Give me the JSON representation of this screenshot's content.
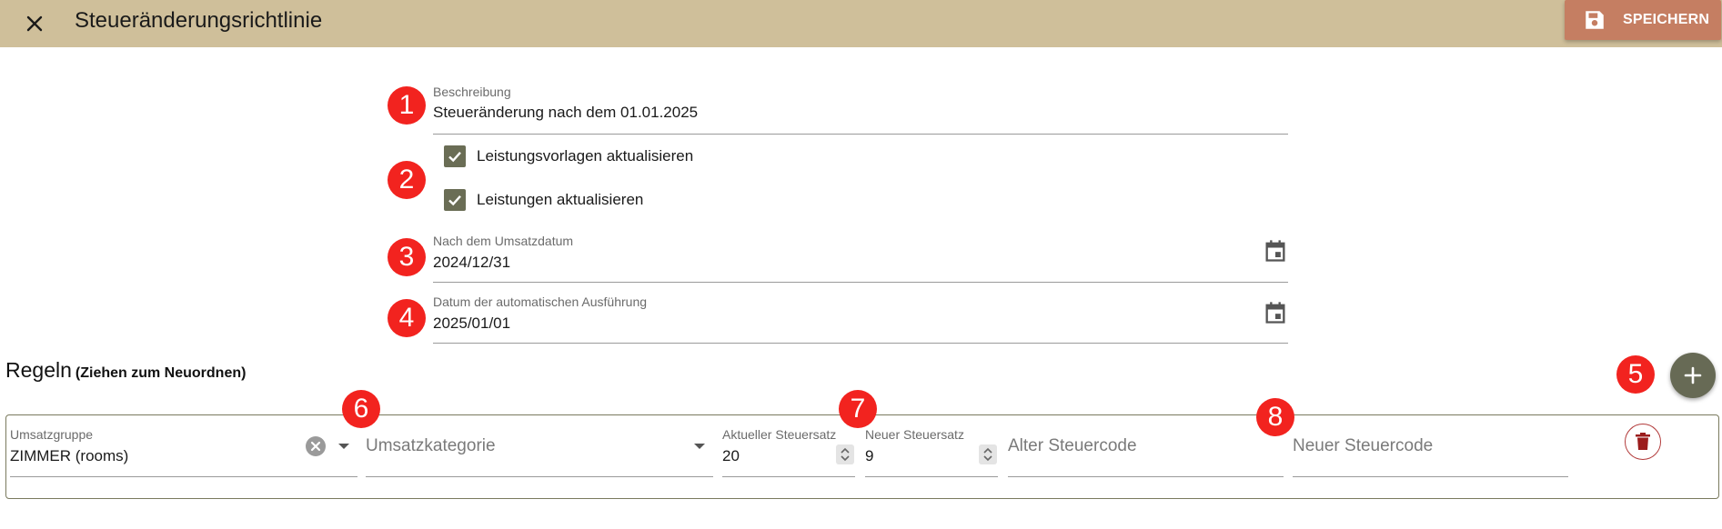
{
  "header": {
    "title": "Steueränderungsrichtlinie",
    "save_label": "SPEICHERN"
  },
  "form": {
    "description": {
      "label": "Beschreibung",
      "value": "Steueränderung nach dem 01.01.2025"
    },
    "checkboxes": [
      {
        "label": "Leistungsvorlagen aktualisieren",
        "checked": true
      },
      {
        "label": "Leistungen aktualisieren",
        "checked": true
      }
    ],
    "after_date": {
      "label": "Nach dem Umsatzdatum",
      "value": "2024/12/31"
    },
    "execution_date": {
      "label": "Datum der automatischen Ausführung",
      "value": "2025/01/01"
    }
  },
  "rules": {
    "title": "Regeln",
    "subtitle": "(Ziehen zum Neuordnen)",
    "row": {
      "revenue_group": {
        "label": "Umsatzgruppe",
        "value": "ZIMMER (rooms)"
      },
      "revenue_category": {
        "placeholder": "Umsatzkategorie"
      },
      "current_rate": {
        "label": "Aktueller Steuersatz",
        "value": "20"
      },
      "new_rate": {
        "label": "Neuer Steuersatz",
        "value": "9"
      },
      "old_code": {
        "placeholder": "Alter Steuercode"
      },
      "new_code": {
        "placeholder": "Neuer Steuercode"
      }
    }
  },
  "annotations": [
    "1",
    "2",
    "3",
    "4",
    "5",
    "6",
    "7",
    "8"
  ],
  "colors": {
    "header_bg": "#cfbf9a",
    "save_bg": "#c57e62",
    "checkbox": "#6a6d55",
    "add_button": "#676a55",
    "badge": "#f2231f",
    "delete": "#9b1c1c"
  },
  "icons": {
    "close": "close-icon",
    "save": "floppy-disk-icon",
    "calendar": "calendar-icon",
    "add": "plus-icon",
    "clear": "clear-circle-icon",
    "dropdown": "caret-down-icon",
    "delete": "trash-icon"
  }
}
